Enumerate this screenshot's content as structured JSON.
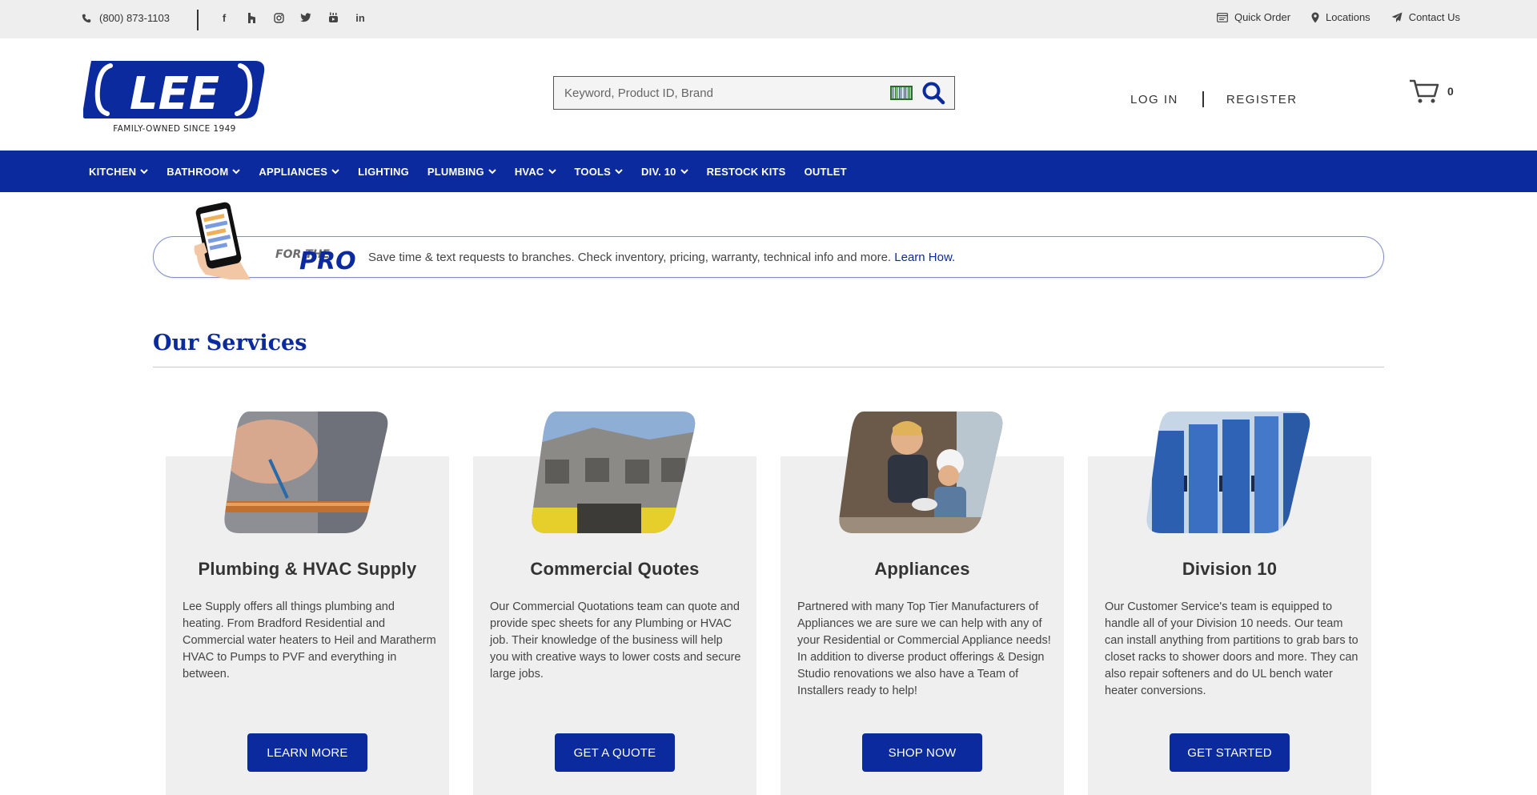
{
  "topbar": {
    "phone": "(800) 873-1103",
    "social": [
      "facebook-icon",
      "houzz-icon",
      "instagram-icon",
      "twitter-icon",
      "youtube-icon",
      "linkedin-icon"
    ],
    "links": [
      {
        "label": "Quick Order",
        "icon": "quick-order-icon"
      },
      {
        "label": "Locations",
        "icon": "location-pin-icon"
      },
      {
        "label": "Contact Us",
        "icon": "paper-plane-icon"
      }
    ]
  },
  "header": {
    "logo_text": "LEE",
    "logo_tagline": "FAMILY-OWNED SINCE 1949",
    "search_placeholder": "Keyword, Product ID, Brand",
    "login": "LOG IN",
    "register": "REGISTER",
    "cart_count": "0"
  },
  "nav": {
    "items": [
      {
        "label": "KITCHEN",
        "dropdown": true
      },
      {
        "label": "BATHROOM",
        "dropdown": true
      },
      {
        "label": "APPLIANCES",
        "dropdown": true
      },
      {
        "label": "LIGHTING",
        "dropdown": false
      },
      {
        "label": "PLUMBING",
        "dropdown": true
      },
      {
        "label": "HVAC",
        "dropdown": true
      },
      {
        "label": "TOOLS",
        "dropdown": true
      },
      {
        "label": "DIV. 10",
        "dropdown": true
      },
      {
        "label": "RESTOCK KITS",
        "dropdown": false
      },
      {
        "label": "OUTLET",
        "dropdown": false
      }
    ]
  },
  "pro_banner": {
    "for_the": "FOR THE",
    "pro": "PRO",
    "text": "Save time & text requests to branches. Check inventory, pricing, warranty, technical info and more. ",
    "link": "Learn How."
  },
  "services": {
    "title": "Our Services",
    "cards": [
      {
        "title": "Plumbing & HVAC Supply",
        "body": "Lee Supply offers all things plumbing and heating. From Bradford Residential and Commercial water heaters to Heil and Maratherm HVAC to Pumps to PVF and everything in between.",
        "button": "LEARN MORE"
      },
      {
        "title": "Commercial Quotes",
        "body": "Our Commercial Quotations team can quote and provide spec sheets for any Plumbing or HVAC job. Their knowledge of the business will help you with creative ways to lower costs and secure large jobs.",
        "button": "GET A QUOTE"
      },
      {
        "title": "Appliances",
        "body": "Partnered with many Top Tier Manufacturers of Appliances we are sure we can help with any of your Residential or Commercial Appliance needs! In addition to diverse product offerings & Design Studio renovations we also have a Team of Installers ready to help!",
        "button": "SHOP NOW"
      },
      {
        "title": "Division 10",
        "body": "Our Customer Service's team is equipped to handle all of your Division 10 needs. Our team can install anything from partitions to grab bars to closet racks to shower doors and more. They can also repair softeners and do UL bench water heater conversions.",
        "button": "GET STARTED"
      }
    ]
  },
  "colors": {
    "brand_blue": "#0b2a9e",
    "topbar_bg": "#eeeeee",
    "card_bg": "#efefef"
  }
}
